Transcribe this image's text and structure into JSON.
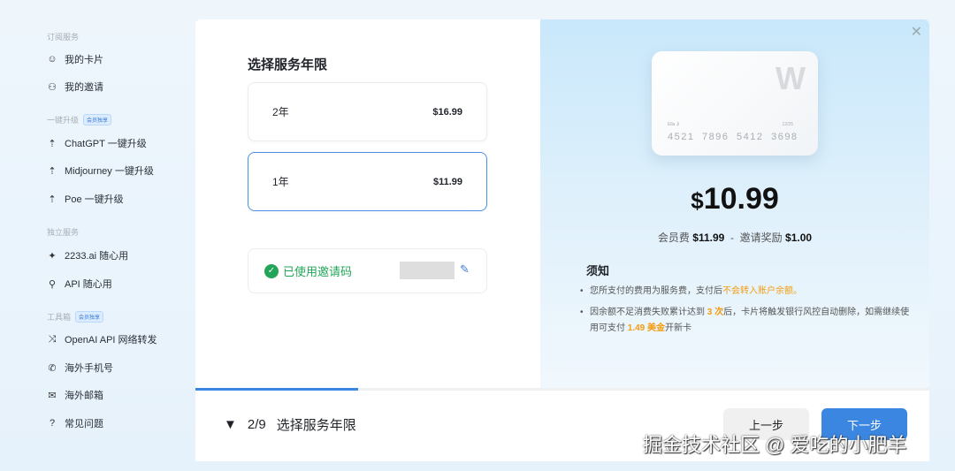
{
  "sidebar": {
    "sections": [
      {
        "label": "订阅服务"
      },
      {
        "label": "一键升级",
        "badge": "会员独享"
      },
      {
        "label": "独立服务"
      },
      {
        "label": "工具箱",
        "badge": "会员独享"
      }
    ],
    "items": [
      {
        "label": "我的卡片",
        "icon": "card-hand-icon"
      },
      {
        "label": "我的邀请",
        "icon": "users-icon"
      },
      {
        "label": "ChatGPT 一键升级",
        "icon": "cloud-upload-icon"
      },
      {
        "label": "Midjourney 一键升级",
        "icon": "cloud-upload-icon"
      },
      {
        "label": "Poe 一键升级",
        "icon": "cloud-upload-icon"
      },
      {
        "label": "2233.ai 随心用",
        "icon": "sparkle-icon"
      },
      {
        "label": "API 随心用",
        "icon": "link-icon"
      },
      {
        "label": "OpenAI API 网络转发",
        "icon": "shuffle-icon"
      },
      {
        "label": "海外手机号",
        "icon": "phone-icon"
      },
      {
        "label": "海外邮箱",
        "icon": "mail-icon"
      },
      {
        "label": "常见问题",
        "icon": "help-icon"
      }
    ]
  },
  "modal": {
    "title": "选择服务年限",
    "options": [
      {
        "label": "2年",
        "price": "$16.99",
        "selected": false
      },
      {
        "label": "1年",
        "price": "$11.99",
        "selected": true
      }
    ],
    "invite": {
      "label": "已使用邀请码"
    },
    "card": {
      "logo": "W",
      "name": "Ella Ji",
      "expiry": "12/25",
      "number": "4521 7896 5412 3698"
    },
    "total": {
      "currency": "$",
      "amount": "10.99"
    },
    "breakdown": {
      "fee_label": "会员费",
      "fee": "$11.99",
      "sep": "-",
      "reward_label": "邀请奖励",
      "reward": "$1.00"
    },
    "notice": {
      "title": "须知",
      "n1_a": "您所支付的费用为服务费，支付后",
      "n1_b": "不会转入账户余额。",
      "n2_a": "因余额不足消费失败累计达到 ",
      "n2_b": "3 次",
      "n2_c": "后，卡片将触发银行风控自动删除，如需继续使用可支付 ",
      "n2_d": "1.49 美金",
      "n2_e": "开新卡"
    },
    "progress": 0.222,
    "step": {
      "arrow": "▼",
      "count": "2/9",
      "label": "选择服务年限"
    },
    "prev": "上一步",
    "next": "下一步"
  },
  "watermark": "掘金技术社区 @ 爱吃的小肥羊"
}
